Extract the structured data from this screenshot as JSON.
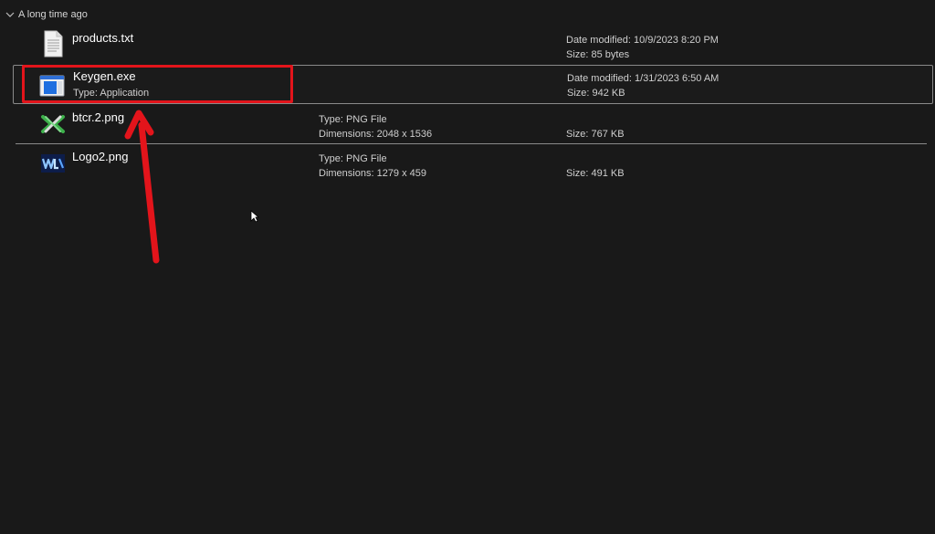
{
  "group": {
    "title": "A long time ago",
    "chevron_icon": "chevron-down-icon"
  },
  "files": [
    {
      "name": "products.txt",
      "icon": "text-file-icon",
      "sub": "",
      "col2_line1": "",
      "col2_line2": "",
      "col3_line1": "Date modified: 10/9/2023 8:20 PM",
      "col3_line2": "Size: 85 bytes"
    },
    {
      "name": "Keygen.exe",
      "icon": "application-icon",
      "sub": "Type: Application",
      "col2_line1": "",
      "col2_line2": "",
      "col3_line1": "Date modified: 1/31/2023 6:50 AM",
      "col3_line2": "Size: 942 KB",
      "selected": true
    },
    {
      "name": "btcr.2.png",
      "icon": "png-image-icon",
      "sub": "",
      "col2_line1": "Type: PNG File",
      "col2_line2": "Dimensions: 2048 x 1536",
      "col3_line1": "",
      "col3_line2": "Size: 767 KB"
    },
    {
      "name": "Logo2.png",
      "icon": "png-image-icon",
      "sub": "",
      "col2_line1": "Type: PNG File",
      "col2_line2": "Dimensions: 1279 x 459",
      "col3_line1": "",
      "col3_line2": "Size: 491 KB"
    }
  ],
  "colors": {
    "background": "#191919",
    "annotation_red": "#e3141b",
    "selection_border": "#8a8a8a"
  },
  "annotations": {
    "highlight_box": "red-rectangle-highlight",
    "arrow": "red-arrow-pointing-up"
  }
}
